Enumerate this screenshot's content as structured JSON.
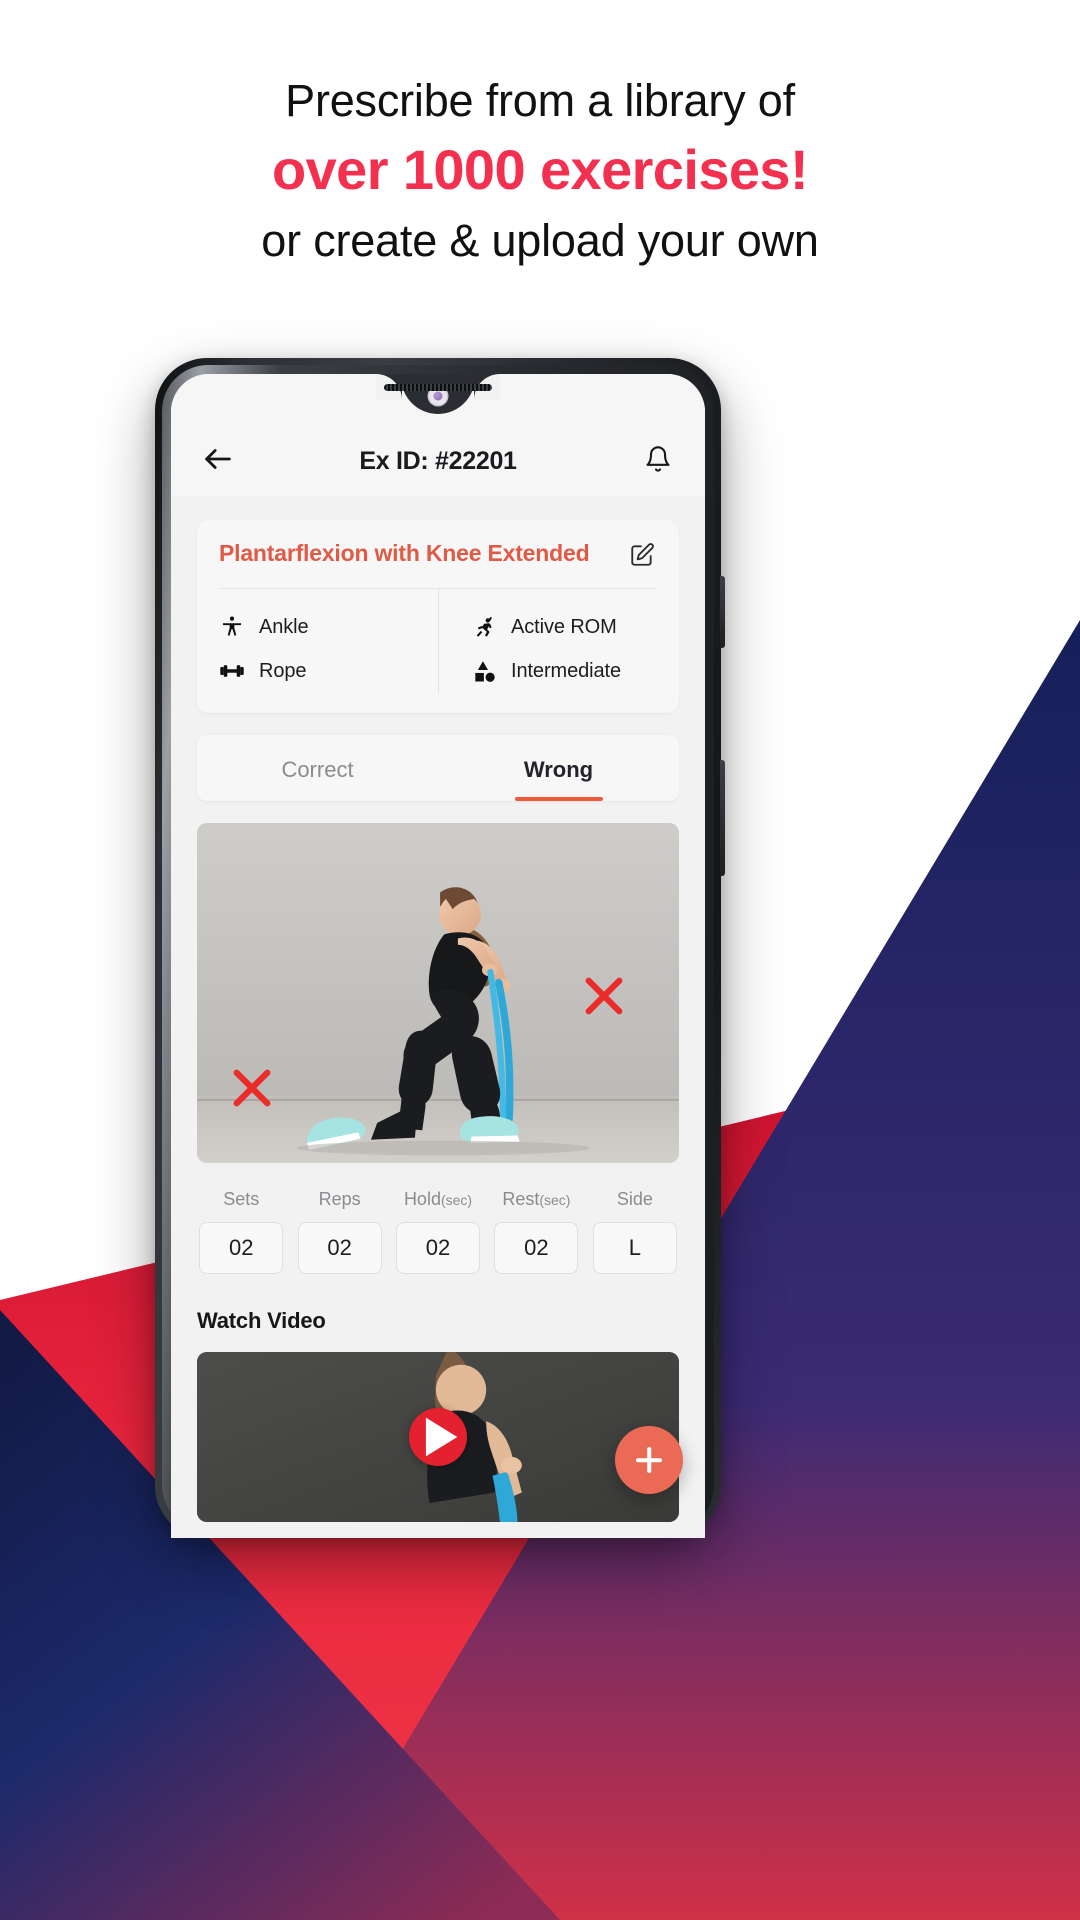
{
  "headline": {
    "line1": "Prescribe from a library of",
    "line2": "over 1000 exercises!",
    "line3": "or create & upload your own",
    "accent_color": "#f43050"
  },
  "phone": {
    "appbar": {
      "back_icon": "arrow-left-icon",
      "title": "Ex ID: #22201",
      "notification_icon": "bell-icon"
    },
    "exercise_card": {
      "title": "Plantarflexion with Knee Extended",
      "title_color": "#e05a45",
      "edit_icon": "edit-pencil-icon",
      "attributes": [
        {
          "icon": "body-part-icon",
          "label": "Ankle"
        },
        {
          "icon": "equipment-dumbbell-icon",
          "label": "Rope"
        },
        {
          "icon": "running-person-icon",
          "label": "Active ROM"
        },
        {
          "icon": "shapes-difficulty-icon",
          "label": "Intermediate"
        }
      ]
    },
    "tabs": [
      {
        "label": "Correct",
        "active": false
      },
      {
        "label": "Wrong",
        "active": true
      }
    ],
    "tab_indicator_color": "#f05a3c",
    "stats": [
      {
        "label": "Sets",
        "sub": "",
        "value": "02"
      },
      {
        "label": "Reps",
        "sub": "",
        "value": "02"
      },
      {
        "label": "Hold",
        "sub": "(sec)",
        "value": "02"
      },
      {
        "label": "Rest",
        "sub": "(sec)",
        "value": "02"
      },
      {
        "label": "Side",
        "sub": "",
        "value": "L"
      }
    ],
    "video_section": {
      "title": "Watch Video",
      "play_icon": "play-icon",
      "play_color": "#e4212e"
    },
    "fab": {
      "icon": "plus-icon",
      "color": "#ea6a55"
    }
  }
}
